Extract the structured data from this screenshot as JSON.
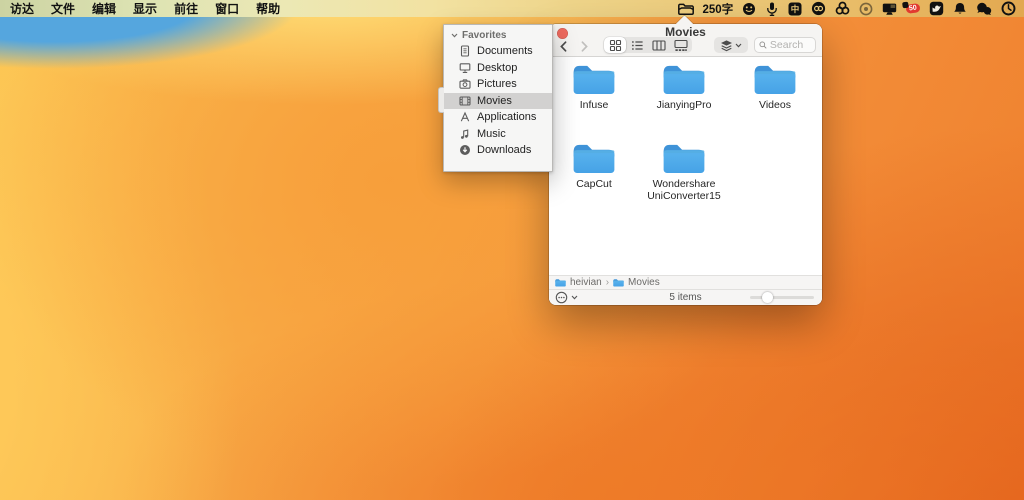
{
  "menu_bar": {
    "app_menu": "访达",
    "menus": [
      "文件",
      "编辑",
      "显示",
      "前往",
      "窗口",
      "帮助"
    ],
    "word_count": "250字",
    "notification_badge": "50",
    "input_method_label": "中",
    "status_icons": [
      "open-folder-icon",
      "emoji-icon",
      "microphone-icon",
      "input-method-icon",
      "creative-cloud-icon",
      "color-rings-icon",
      "status-circle-icon",
      "display-icon",
      "red-badge-50-icon",
      "bird-app-icon",
      "bell-icon",
      "chat-bubbles-icon",
      "clock-icon"
    ]
  },
  "panel": {
    "header": "Favorites",
    "items": [
      {
        "label": "Documents",
        "icon": "document-icon"
      },
      {
        "label": "Desktop",
        "icon": "desktop-icon"
      },
      {
        "label": "Pictures",
        "icon": "camera-icon"
      },
      {
        "label": "Movies",
        "icon": "film-icon",
        "selected": true
      },
      {
        "label": "Applications",
        "icon": "applications-icon"
      },
      {
        "label": "Music",
        "icon": "music-note-icon"
      },
      {
        "label": "Downloads",
        "icon": "download-circle-icon"
      }
    ]
  },
  "window": {
    "title": "Movies",
    "toolbar": {
      "search_placeholder": "Search"
    },
    "folders": [
      "Infuse",
      "JianyingPro",
      "Videos",
      "CapCut",
      "Wondershare UniConverter15"
    ],
    "path": [
      "heivian",
      "Movies"
    ],
    "path_separator": "›",
    "status_text": "5 items"
  },
  "colors": {
    "folder_blue_light": "#5ab4ee",
    "folder_blue_dark": "#46a2e6",
    "folder_tab": "#3f93d8",
    "selection_gray": "#d2d1d0",
    "traffic_red": "#ee6a5f",
    "badge_red": "#e23a30",
    "wallpaper_orange": "#f4903a",
    "wallpaper_yellow": "#fcc653",
    "sky_blue": "#55a6de"
  }
}
